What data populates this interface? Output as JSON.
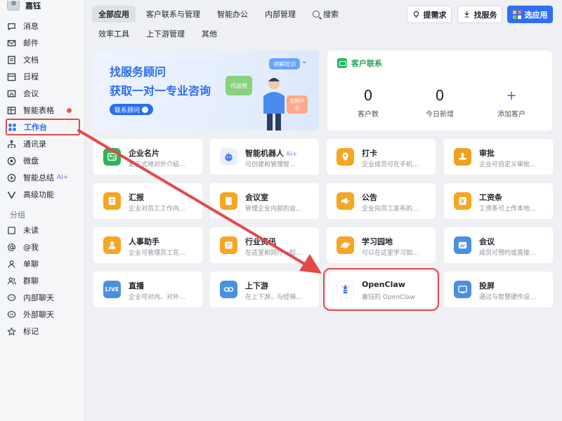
{
  "user": {
    "name": "嘉钰"
  },
  "sidebar": {
    "items": [
      {
        "label": "消息",
        "icon": "chat-icon"
      },
      {
        "label": "邮件",
        "icon": "mail-icon"
      },
      {
        "label": "文档",
        "icon": "document-icon"
      },
      {
        "label": "日程",
        "icon": "calendar-icon"
      },
      {
        "label": "会议",
        "icon": "meeting-icon"
      },
      {
        "label": "智能表格",
        "icon": "table-icon"
      },
      {
        "label": "工作台",
        "icon": "workbench-icon"
      },
      {
        "label": "通讯录",
        "icon": "contacts-icon"
      },
      {
        "label": "微盘",
        "icon": "drive-icon"
      },
      {
        "label": "智能总结",
        "icon": "summary-icon",
        "tag": "AI+"
      },
      {
        "label": "高级功能",
        "icon": "advanced-icon"
      }
    ],
    "group_title": "分组",
    "groups": [
      {
        "label": "未读",
        "icon": "unread-icon"
      },
      {
        "label": "@我",
        "icon": "at-icon"
      },
      {
        "label": "单聊",
        "icon": "single-chat-icon"
      },
      {
        "label": "群聊",
        "icon": "group-chat-icon"
      },
      {
        "label": "内部聊天",
        "icon": "internal-chat-icon"
      },
      {
        "label": "外部聊天",
        "icon": "external-chat-icon"
      },
      {
        "label": "标记",
        "icon": "star-icon"
      }
    ]
  },
  "header": {
    "tabs": [
      "全部应用",
      "客户联系与管理",
      "智能办公",
      "内部管理"
    ],
    "search_label": "搜索",
    "tabs_row2": [
      "效率工具",
      "上下游管理",
      "其他"
    ],
    "btn_request": "提需求",
    "btn_service": "找服务",
    "btn_choose": "选应用"
  },
  "banner": {
    "title1": "找服务顾问",
    "title2": "获取一对一专业咨询",
    "cta": "联系顾问",
    "bubble1": "讲解培训",
    "bubble2": "代运营",
    "bubble3": "定制开发"
  },
  "contacts": {
    "title": "客户联系",
    "customers_value": "0",
    "customers_label": "客户数",
    "today_value": "0",
    "today_label": "今日新增",
    "add_label": "添加客户",
    "add_symbol": "+"
  },
  "apps": [
    {
      "name": "企业名片",
      "desc": "更正式地对外介绍...",
      "color": "#2fb45a",
      "icon": "business-card-icon"
    },
    {
      "name": "智能机器人",
      "tag": "AI+",
      "desc": "可创建和管理智...",
      "color": "#e8f0ff",
      "icon": "robot-icon"
    },
    {
      "name": "打卡",
      "desc": "企业成员可在手机...",
      "color": "#f5a623",
      "icon": "location-icon"
    },
    {
      "name": "审批",
      "desc": "企业可自定义审批...",
      "color": "#f0a020",
      "icon": "stamp-icon"
    },
    {
      "name": "汇报",
      "desc": "企业对员工工作内...",
      "color": "#f5a623",
      "icon": "report-icon"
    },
    {
      "name": "会议室",
      "desc": "管理企业内部的会...",
      "color": "#f5a623",
      "icon": "door-icon"
    },
    {
      "name": "公告",
      "desc": "企业向员工发布的...",
      "color": "#f5a623",
      "icon": "megaphone-icon"
    },
    {
      "name": "工资条",
      "desc": "工资条可上传本地...",
      "color": "#f5a623",
      "icon": "yen-icon"
    },
    {
      "name": "人事助手",
      "desc": "企业可管理员工花...",
      "color": "#f5a623",
      "icon": "hr-icon"
    },
    {
      "name": "行业资讯",
      "desc": "在这里和同行一起...",
      "color": "#f5a623",
      "icon": "news-icon"
    },
    {
      "name": "学习园地",
      "desc": "可以在这里学习如...",
      "color": "#f5a623",
      "icon": "planet-icon"
    },
    {
      "name": "会议",
      "desc": "成员可预约或直接...",
      "color": "#4a90e2",
      "icon": "meeting-app-icon"
    },
    {
      "name": "直播",
      "desc": "企业可对内、对外...",
      "color": "#4a90e2",
      "icon": "live-icon",
      "badge": "LIVE"
    },
    {
      "name": "上下游",
      "desc": "在上下游，与经销...",
      "color": "#4a90e2",
      "icon": "link-icon"
    },
    {
      "name": "OpenClaw",
      "desc": "嘉钰的 OpenClaw",
      "color": "#ffffff",
      "icon": "lighthouse-icon"
    },
    {
      "name": "投屏",
      "desc": "通过与智慧硬件设...",
      "color": "#4a90e2",
      "icon": "cast-icon"
    }
  ]
}
